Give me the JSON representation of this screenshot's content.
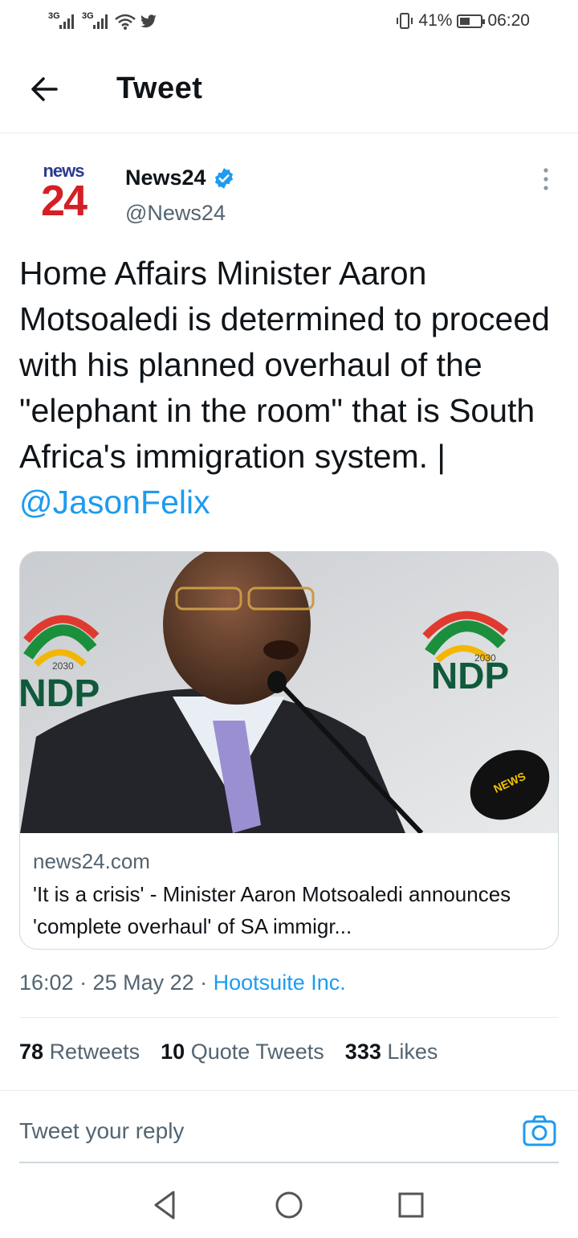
{
  "status_bar": {
    "signal1": "3G",
    "signal2": "3G",
    "battery": "41%",
    "time": "06:20"
  },
  "header": {
    "title": "Tweet"
  },
  "tweet": {
    "logo_top": "news",
    "logo_bottom": "24",
    "author_name": "News24",
    "handle": "@News24",
    "text": "Home Affairs Minister Aaron Motsoaledi is determined to proceed with his planned overhaul of the \"elephant in the room\" that is South Africa's immigration system. | ",
    "mention": "@JasonFelix",
    "time_date": "16:02 · 25 May 22 · ",
    "source": "Hootsuite Inc."
  },
  "card": {
    "domain": "news24.com",
    "title": "'It is a crisis' - Minister Aaron Motsoaledi announces 'complete overhaul' of SA immigr...",
    "photo_text_left": "NDP",
    "photo_text_right": "NDP",
    "photo_year_left": "2030",
    "photo_year_right": "2030",
    "photo_mic_label": "NEWS"
  },
  "stats": {
    "retweets_count": "78",
    "retweets_label": "Retweets",
    "quotes_count": "10",
    "quotes_label": "Quote Tweets",
    "likes_count": "333",
    "likes_label": "Likes"
  },
  "reply": {
    "placeholder": "Tweet your reply"
  },
  "colors": {
    "accent": "#1d9bf0",
    "text": "#0f1419",
    "muted": "#536471",
    "logo_blue": "#2b3a8f",
    "logo_red": "#d51f26"
  }
}
